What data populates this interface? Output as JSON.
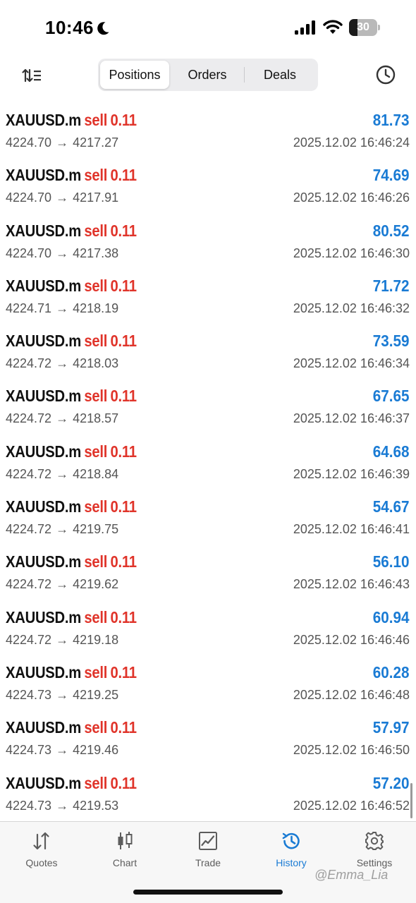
{
  "status_bar": {
    "time": "10:46",
    "battery_level": "30",
    "battery_fraction": 0.3,
    "icons": [
      "moon-icon",
      "cellular-signal-icon",
      "wifi-icon",
      "battery-icon"
    ]
  },
  "header": {
    "sort_icon": "sort-icon",
    "tabs": [
      {
        "label": "Positions",
        "active": true
      },
      {
        "label": "Orders",
        "active": false
      },
      {
        "label": "Deals",
        "active": false
      }
    ],
    "history_icon": "clock-icon"
  },
  "deals": [
    {
      "symbol": "XAUUSD.m",
      "type": "sell",
      "volume": "0.11",
      "profit": "81.73",
      "open_price": "4224.70",
      "arrow": "→",
      "close_price": "4217.27",
      "time": "2025.12.02 16:46:24"
    },
    {
      "symbol": "XAUUSD.m",
      "type": "sell",
      "volume": "0.11",
      "profit": "74.69",
      "open_price": "4224.70",
      "arrow": "→",
      "close_price": "4217.91",
      "time": "2025.12.02 16:46:26"
    },
    {
      "symbol": "XAUUSD.m",
      "type": "sell",
      "volume": "0.11",
      "profit": "80.52",
      "open_price": "4224.70",
      "arrow": "→",
      "close_price": "4217.38",
      "time": "2025.12.02 16:46:30"
    },
    {
      "symbol": "XAUUSD.m",
      "type": "sell",
      "volume": "0.11",
      "profit": "71.72",
      "open_price": "4224.71",
      "arrow": "→",
      "close_price": "4218.19",
      "time": "2025.12.02 16:46:32"
    },
    {
      "symbol": "XAUUSD.m",
      "type": "sell",
      "volume": "0.11",
      "profit": "73.59",
      "open_price": "4224.72",
      "arrow": "→",
      "close_price": "4218.03",
      "time": "2025.12.02 16:46:34"
    },
    {
      "symbol": "XAUUSD.m",
      "type": "sell",
      "volume": "0.11",
      "profit": "67.65",
      "open_price": "4224.72",
      "arrow": "→",
      "close_price": "4218.57",
      "time": "2025.12.02 16:46:37"
    },
    {
      "symbol": "XAUUSD.m",
      "type": "sell",
      "volume": "0.11",
      "profit": "64.68",
      "open_price": "4224.72",
      "arrow": "→",
      "close_price": "4218.84",
      "time": "2025.12.02 16:46:39"
    },
    {
      "symbol": "XAUUSD.m",
      "type": "sell",
      "volume": "0.11",
      "profit": "54.67",
      "open_price": "4224.72",
      "arrow": "→",
      "close_price": "4219.75",
      "time": "2025.12.02 16:46:41"
    },
    {
      "symbol": "XAUUSD.m",
      "type": "sell",
      "volume": "0.11",
      "profit": "56.10",
      "open_price": "4224.72",
      "arrow": "→",
      "close_price": "4219.62",
      "time": "2025.12.02 16:46:43"
    },
    {
      "symbol": "XAUUSD.m",
      "type": "sell",
      "volume": "0.11",
      "profit": "60.94",
      "open_price": "4224.72",
      "arrow": "→",
      "close_price": "4219.18",
      "time": "2025.12.02 16:46:46"
    },
    {
      "symbol": "XAUUSD.m",
      "type": "sell",
      "volume": "0.11",
      "profit": "60.28",
      "open_price": "4224.73",
      "arrow": "→",
      "close_price": "4219.25",
      "time": "2025.12.02 16:46:48"
    },
    {
      "symbol": "XAUUSD.m",
      "type": "sell",
      "volume": "0.11",
      "profit": "57.97",
      "open_price": "4224.73",
      "arrow": "→",
      "close_price": "4219.46",
      "time": "2025.12.02 16:46:50"
    },
    {
      "symbol": "XAUUSD.m",
      "type": "sell",
      "volume": "0.11",
      "profit": "57.20",
      "open_price": "4224.73",
      "arrow": "→",
      "close_price": "4219.53",
      "time": "2025.12.02 16:46:52"
    }
  ],
  "tab_bar": [
    {
      "label": "Quotes",
      "icon": "quotes-arrows-icon",
      "active": false
    },
    {
      "label": "Chart",
      "icon": "candlestick-chart-icon",
      "active": false
    },
    {
      "label": "Trade",
      "icon": "trade-line-chart-icon",
      "active": false
    },
    {
      "label": "History",
      "icon": "history-clock-icon",
      "active": true
    },
    {
      "label": "Settings",
      "icon": "gear-icon",
      "active": false
    }
  ],
  "watermark": "@Emma_Lia",
  "colors": {
    "sell": "#e0342a",
    "profit": "#1a7bd4",
    "active_tab": "#1a7bd4",
    "secondary_text": "#555555"
  }
}
